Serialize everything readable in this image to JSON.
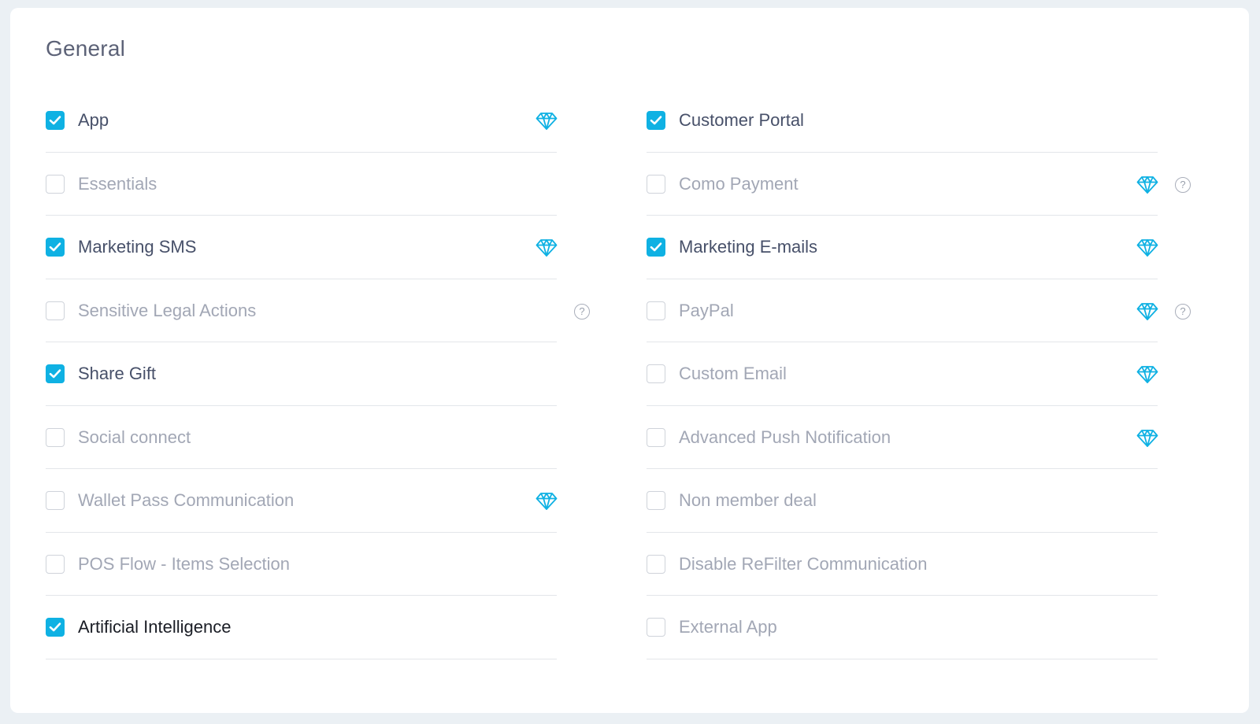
{
  "section": {
    "title": "General"
  },
  "colors": {
    "accent": "#0fb1e3",
    "label_active": "#475069",
    "label_inactive": "#a2a7b5",
    "divider": "#e3e6ea",
    "page_background": "#ebf0f4"
  },
  "icons": {
    "premium": "diamond-icon",
    "help": "question-circle-icon",
    "help_glyph": "?",
    "check": "checkmark-icon"
  },
  "left_features": [
    {
      "label": "App",
      "checked": true,
      "premium": true,
      "help": false
    },
    {
      "label": "Essentials",
      "checked": false,
      "premium": false,
      "help": false
    },
    {
      "label": "Marketing SMS",
      "checked": true,
      "premium": true,
      "help": false
    },
    {
      "label": "Sensitive Legal Actions",
      "checked": false,
      "premium": false,
      "help": true
    },
    {
      "label": "Share Gift",
      "checked": true,
      "premium": false,
      "help": false
    },
    {
      "label": "Social connect",
      "checked": false,
      "premium": false,
      "help": false
    },
    {
      "label": "Wallet Pass Communication",
      "checked": false,
      "premium": true,
      "help": false
    },
    {
      "label": "POS Flow - Items Selection",
      "checked": false,
      "premium": false,
      "help": false
    },
    {
      "label": "Artificial Intelligence",
      "checked": true,
      "premium": false,
      "help": false
    }
  ],
  "right_features": [
    {
      "label": "Customer Portal",
      "checked": true,
      "premium": false,
      "help": false
    },
    {
      "label": "Como Payment",
      "checked": false,
      "premium": true,
      "help": true
    },
    {
      "label": "Marketing E-mails",
      "checked": true,
      "premium": true,
      "help": false
    },
    {
      "label": "PayPal",
      "checked": false,
      "premium": true,
      "help": true
    },
    {
      "label": "Custom Email",
      "checked": false,
      "premium": true,
      "help": false
    },
    {
      "label": "Advanced Push Notification",
      "checked": false,
      "premium": true,
      "help": false
    },
    {
      "label": "Non member deal",
      "checked": false,
      "premium": false,
      "help": false
    },
    {
      "label": "Disable ReFilter Communication",
      "checked": false,
      "premium": false,
      "help": false
    },
    {
      "label": "External App",
      "checked": false,
      "premium": false,
      "help": false
    }
  ]
}
